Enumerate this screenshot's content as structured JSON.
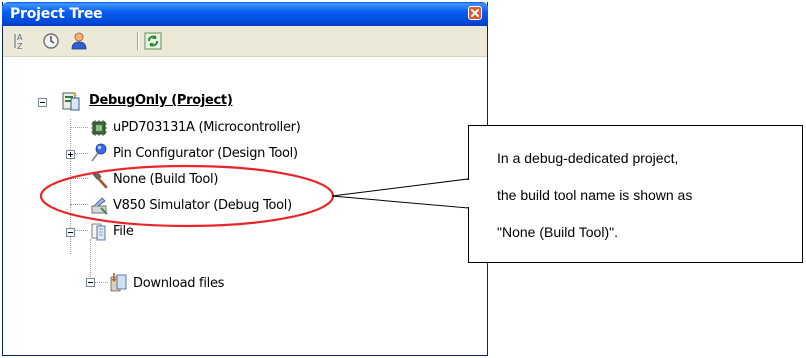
{
  "panel": {
    "title": "Project Tree",
    "toolbar": {
      "buttons": [
        {
          "name": "sort-icon"
        },
        {
          "name": "clock-icon"
        },
        {
          "name": "user-icon"
        },
        {
          "name": "refresh-icon"
        }
      ]
    }
  },
  "tree": {
    "root": {
      "label": "DebugOnly (Project)",
      "icon": "project-icon",
      "expanded": true
    },
    "items": [
      {
        "label": "uPD703131A (Microcontroller)",
        "icon": "chip-icon"
      },
      {
        "label": "Pin Configurator (Design Tool)",
        "icon": "pin-icon",
        "expandable": true,
        "expanded": false
      },
      {
        "label": "None (Build Tool)",
        "icon": "hammer-icon"
      },
      {
        "label": "V850 Simulator (Debug Tool)",
        "icon": "simulator-icon"
      },
      {
        "label": "File",
        "icon": "folder-icon",
        "expandable": true,
        "expanded": true
      },
      {
        "label": "Download files",
        "icon": "download-files-icon",
        "expandable": true,
        "expanded": true
      }
    ]
  },
  "callout": {
    "lines": [
      "In a debug-dedicated project,",
      "the build tool name is shown as",
      "\"None (Build Tool)\"."
    ]
  },
  "colors": {
    "title_bar": "#0a5ef2",
    "highlight_ellipse": "#e8262a",
    "toolbar": "#ece9d8"
  }
}
